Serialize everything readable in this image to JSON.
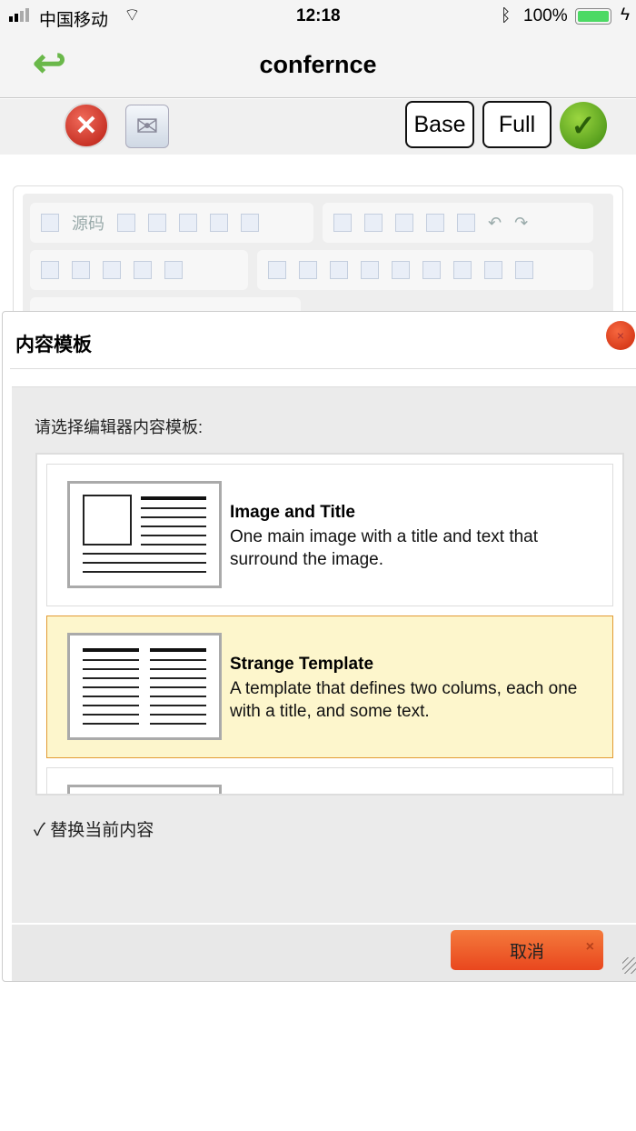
{
  "status": {
    "carrier": "中国移动",
    "time": "12:18",
    "battery": "100%"
  },
  "nav": {
    "title": "confernce"
  },
  "toolbar": {
    "base_label": "Base",
    "full_label": "Full"
  },
  "editor": {
    "source_label": "源码"
  },
  "dialog": {
    "title": "内容模板",
    "close": "×",
    "prompt": "请选择编辑器内容模板:",
    "templates": [
      {
        "title": "Image and Title",
        "description": "One main image with a title and text that surround the image.",
        "selected": false
      },
      {
        "title": "Strange Template",
        "description": "A template that defines two colums, each one with a title, and some text.",
        "selected": true
      }
    ],
    "replace_label": "替换当前内容",
    "replace_checked": true,
    "cancel_label": "取消",
    "cancel_icon": "×"
  }
}
